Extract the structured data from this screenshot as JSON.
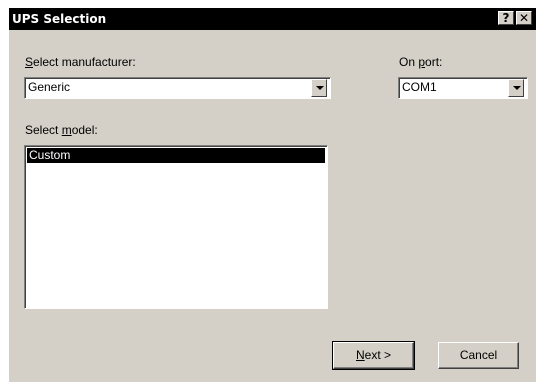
{
  "window": {
    "title": "UPS Selection",
    "help_label": "?",
    "close_label": "✕"
  },
  "manufacturer": {
    "label_prefix": "S",
    "label_rest": "elect manufacturer:",
    "value": "Generic"
  },
  "port": {
    "label_prefix": "On ",
    "label_key": "p",
    "label_rest": "ort:",
    "value": "COM1"
  },
  "model": {
    "label_prefix": "Select ",
    "label_key": "m",
    "label_rest": "odel:",
    "items": [
      "Custom"
    ],
    "selected_index": 0
  },
  "buttons": {
    "next_key": "N",
    "next_rest": "ext >",
    "cancel": "Cancel"
  },
  "icons": {
    "dropdown": "chevron-down-icon",
    "help": "help-icon",
    "close": "close-icon"
  },
  "colors": {
    "title_bar": "#000000",
    "face": "#d4d0c8",
    "selection": "#000000"
  }
}
